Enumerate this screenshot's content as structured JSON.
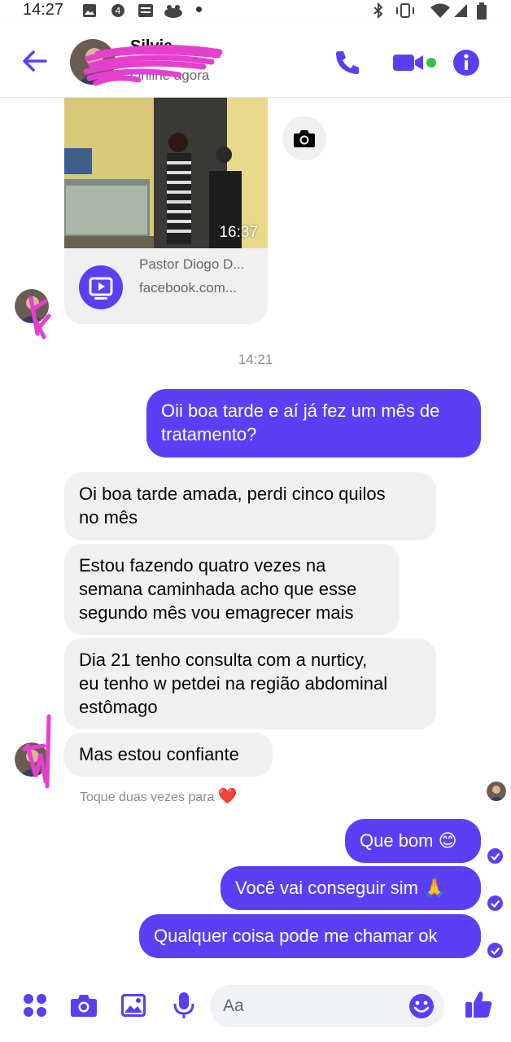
{
  "status_bar": {
    "time": "14:27"
  },
  "header": {
    "contact_name": "Silvia",
    "status": "Online agora",
    "accent": "#5b3ef5"
  },
  "shared_link": {
    "duration": "16:37",
    "title": "Pastor Diogo D...",
    "domain": "facebook.com..."
  },
  "timestamp": "14:21",
  "messages": [
    {
      "dir": "out",
      "lines": [
        "Oii boa tarde e aí já fez um mês de",
        "tratamento?"
      ]
    },
    {
      "dir": "in",
      "lines": [
        "Oi boa tarde amada, perdi cinco quilos",
        "no mês"
      ]
    },
    {
      "dir": "in",
      "lines": [
        "Estou fazendo quatro vezes na",
        "semana caminhada acho que esse",
        "segundo mês vou emagrecer mais"
      ]
    },
    {
      "dir": "in",
      "lines": [
        "Dia 21 tenho consulta com a nurticy,",
        "eu tenho w petdei na região abdominal",
        "estômago"
      ]
    },
    {
      "dir": "in",
      "lines": [
        "Mas estou confiante"
      ]
    },
    {
      "dir": "out",
      "lines": [
        "Que bom 😊"
      ]
    },
    {
      "dir": "out",
      "lines": [
        "Você vai conseguir sim 🙏"
      ]
    },
    {
      "dir": "out",
      "lines": [
        "Qualquer coisa pode me chamar ok"
      ]
    }
  ],
  "reaction_hint": "Toque duas vezes para",
  "reaction_heart": "❤️",
  "composer": {
    "placeholder": "Aa"
  },
  "icons": {
    "back": "back-arrow-icon",
    "call": "phone-icon",
    "video": "video-camera-icon",
    "info": "info-icon",
    "camera_bubble": "camera-icon",
    "more": "four-dots-icon",
    "camera": "camera-icon",
    "gallery": "image-icon",
    "mic": "microphone-icon",
    "emoji": "emoji-icon",
    "like": "thumbs-up-icon"
  }
}
